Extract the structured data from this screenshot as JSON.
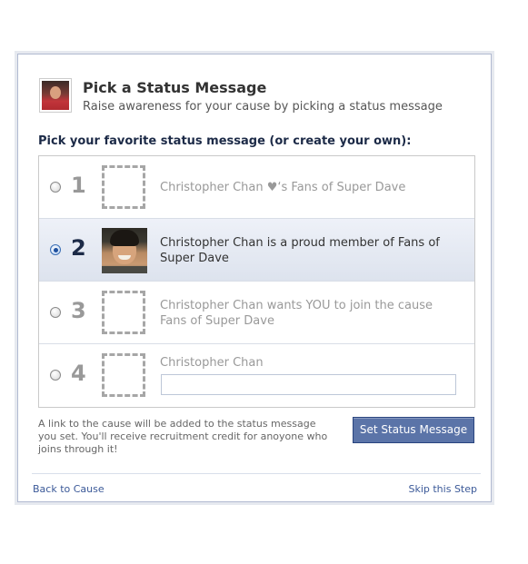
{
  "header": {
    "title": "Pick a Status Message",
    "subtitle": "Raise awareness for your cause by picking a status message",
    "avatar_icon": "user-profile-photo"
  },
  "prompt": "Pick your favorite status message (or create your own):",
  "options": [
    {
      "number": "1",
      "text": "Christopher Chan ♥‘s Fans of Super Dave",
      "selected": false,
      "thumbnail": "empty-placeholder"
    },
    {
      "number": "2",
      "text": "Christopher Chan is a proud member of Fans of Super Dave",
      "selected": true,
      "thumbnail": "profile-photo"
    },
    {
      "number": "3",
      "text": "Christopher Chan wants YOU to join the cause Fans of Super Dave",
      "selected": false,
      "thumbnail": "empty-placeholder"
    },
    {
      "number": "4",
      "text": "Christopher Chan",
      "selected": false,
      "thumbnail": "empty-placeholder",
      "input_value": "",
      "input_placeholder": ""
    }
  ],
  "footnote": "A link to the cause will be added to the status message you set. You'll receive recruitment credit for anoyone who joins through it!",
  "submit_label": "Set Status Message",
  "footer": {
    "back_label": "Back to Cause",
    "skip_label": "Skip this Step"
  },
  "colors": {
    "brand_blue": "#3b5998",
    "button_blue": "#5b74a8",
    "selected_row": "#dde3ee",
    "muted_text": "#999999"
  }
}
